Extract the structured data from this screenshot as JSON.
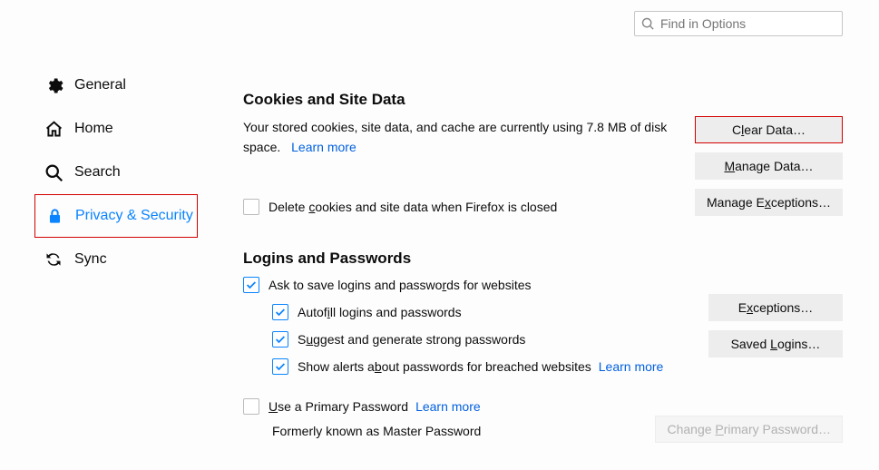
{
  "search": {
    "placeholder": "Find in Options"
  },
  "sidebar": {
    "items": [
      {
        "label": "General"
      },
      {
        "label": "Home"
      },
      {
        "label": "Search"
      },
      {
        "label": "Privacy & Security"
      },
      {
        "label": "Sync"
      }
    ]
  },
  "cookies": {
    "heading": "Cookies and Site Data",
    "desc_prefix": "Your stored cookies, site data, and cache are currently using ",
    "size": "7.8 MB",
    "desc_suffix": " of disk space.",
    "learn_more": "Learn more",
    "delete_label_pre": "Delete ",
    "delete_label_u": "c",
    "delete_label_post": "ookies and site data when Firefox is closed",
    "btn_clear_pre": "C",
    "btn_clear_u": "l",
    "btn_clear_post": "ear Data…",
    "btn_manage_pre": "",
    "btn_manage_u": "M",
    "btn_manage_post": "anage Data…",
    "btn_except_pre": "Manage E",
    "btn_except_u": "x",
    "btn_except_post": "ceptions…"
  },
  "logins": {
    "heading": "Logins and Passwords",
    "ask_pre": "Ask to save logins and passwo",
    "ask_u": "r",
    "ask_post": "ds for websites",
    "autofill_pre": "Autof",
    "autofill_u": "i",
    "autofill_post": "ll logins and passwords",
    "suggest_pre": "S",
    "suggest_u": "u",
    "suggest_post": "ggest and generate strong passwords",
    "alerts_pre": "Show alerts a",
    "alerts_u": "b",
    "alerts_post": "out passwords for breached websites",
    "alerts_learn": "Learn more",
    "primary_pre": "",
    "primary_u": "U",
    "primary_post": "se a Primary Password",
    "primary_learn": "Learn more",
    "former": "Formerly known as Master Password",
    "btn_except_pre": "E",
    "btn_except_u": "x",
    "btn_except_post": "ceptions…",
    "btn_saved_pre": "Saved ",
    "btn_saved_u": "L",
    "btn_saved_post": "ogins…",
    "btn_change_pre": "Change ",
    "btn_change_u": "P",
    "btn_change_post": "rimary Password…"
  }
}
